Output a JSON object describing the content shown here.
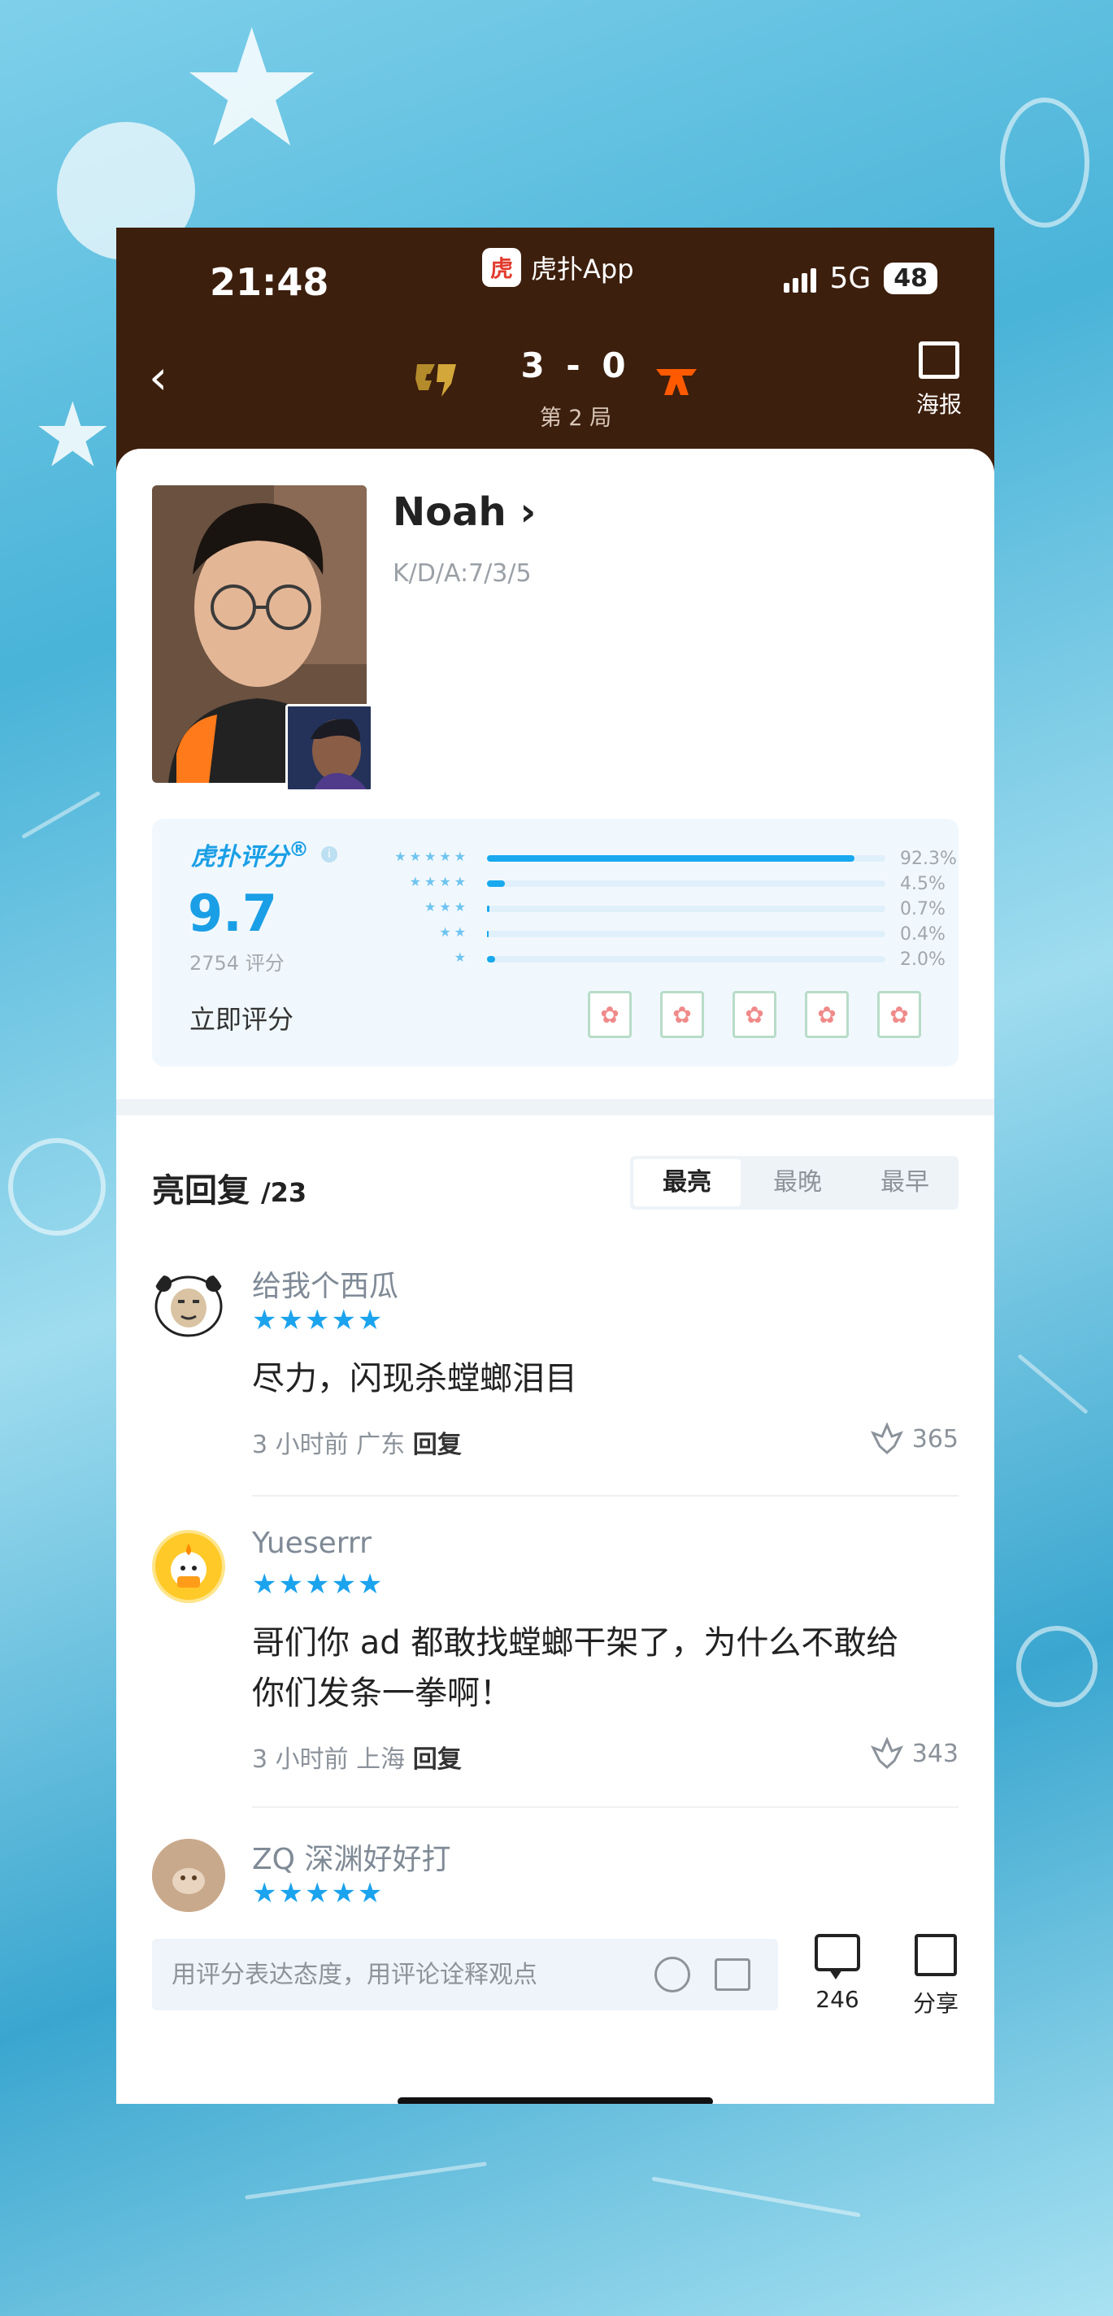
{
  "status_bar": {
    "time": "21:48",
    "app_name": "虎扑App",
    "app_logo": "虎",
    "network": "5G",
    "battery": "48"
  },
  "header": {
    "back_icon": "chevron-left-icon",
    "score": "3 - 0",
    "round": "第 2 局",
    "poster_label": "海报"
  },
  "player": {
    "name": "Noah",
    "kda": "K/D/A:7/3/5"
  },
  "rating": {
    "brand": "虎扑评分",
    "brand_mark": "®",
    "info": "i",
    "score": "9.7",
    "count": "2754 评分",
    "rate_now": "立即评分",
    "distribution": [
      {
        "stars": "★★★★★",
        "percent": "92.3%",
        "value": 92.3
      },
      {
        "stars": "★★★★",
        "percent": "4.5%",
        "value": 4.5
      },
      {
        "stars": "★★★",
        "percent": "0.7%",
        "value": 0.7
      },
      {
        "stars": "★★",
        "percent": "0.4%",
        "value": 0.4
      },
      {
        "stars": "★",
        "percent": "2.0%",
        "value": 2.0
      }
    ],
    "rate_icon": "✿",
    "accent": "#18a9ef"
  },
  "replies": {
    "title": "亮回复",
    "count": "/23",
    "tabs": [
      "最亮",
      "最晚",
      "最早"
    ],
    "active_tab": "最亮"
  },
  "comments": [
    {
      "user": "给我个西瓜",
      "stars": "★★★★★",
      "text": "尽力，闪现杀螳螂泪目",
      "time": "3 小时前",
      "location": "广东",
      "reply": "回复",
      "likes": "365"
    },
    {
      "user": "Yueserrr",
      "stars": "★★★★★",
      "text": "哥们你 ad 都敢找螳螂干架了，为什么不敢给你们发条一拳啊！",
      "time": "3 小时前",
      "location": "上海",
      "reply": "回复",
      "likes": "343"
    },
    {
      "user": "ZQ 深渊好好打",
      "stars": "★★★★★"
    }
  ],
  "bottom": {
    "placeholder": "用评分表达态度，用评论诠释观点",
    "comment_count": "246",
    "share_label": "分享"
  }
}
